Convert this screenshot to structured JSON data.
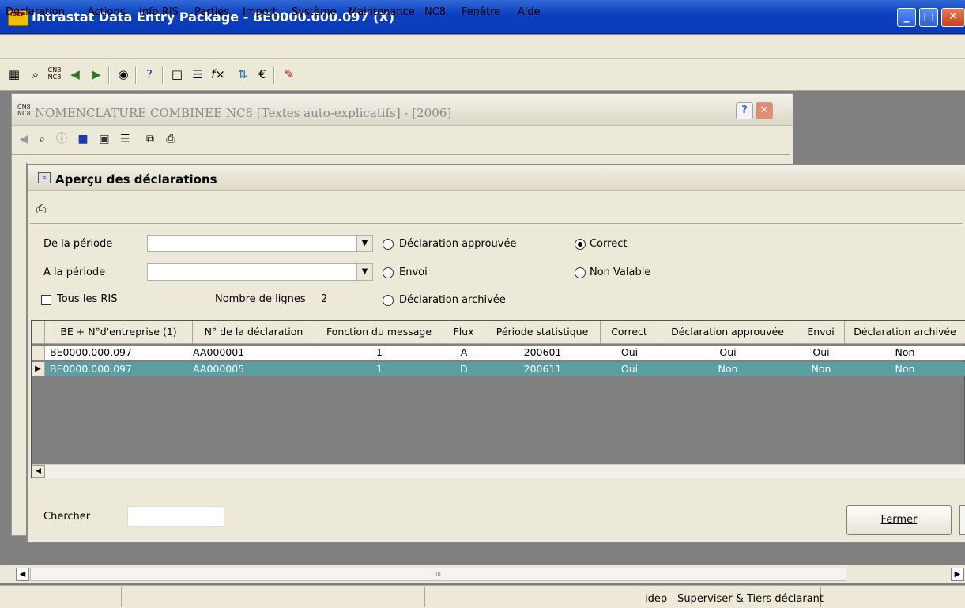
{
  "window": {
    "title": "Intrastat Data Entry Package - BE0000.000.097 (X)",
    "app_icon_text": "IDEP",
    "minimize": "_",
    "maximize": "□",
    "close": "✕"
  },
  "menu": [
    "Déclaration",
    "Actions",
    "Info RIS",
    "Parties",
    "Import",
    "Système",
    "Maintenance",
    "NC8",
    "Fenêtre",
    "Aide"
  ],
  "toolbar_icons": [
    "grid-icon",
    "binoculars-icon",
    "cn8-nc8-icon",
    "arrow-back-icon",
    "arrow-forward-icon",
    "camera-icon",
    "help-icon",
    "new-document-icon",
    "printer-config-icon",
    "function-icon",
    "sort-icon",
    "euro-icon",
    "tools-icon"
  ],
  "nc8_window": {
    "title": "NOMENCLATURE COMBINEE NC8 [Textes auto-explicatifs] - [2006]",
    "icon_text": "CN8\nNC8",
    "help": "?",
    "close": "✕"
  },
  "apercu": {
    "title": "Aperçu des déclarations",
    "from_period_label": "De la période",
    "from_period_value": "",
    "to_period_label": "A la période",
    "to_period_value": "",
    "all_ris_label": "Tous les RIS",
    "all_ris_checked": false,
    "lines_count_label": "Nombre de lignes",
    "lines_count_value": "2",
    "filters_left": [
      {
        "label": "Déclaration approuvée",
        "selected": false
      },
      {
        "label": "Envoi",
        "selected": false
      },
      {
        "label": "Déclaration archivée",
        "selected": false
      }
    ],
    "filters_right": [
      {
        "label": "Correct",
        "selected": true
      },
      {
        "label": "Non Valable",
        "selected": false
      }
    ],
    "columns": [
      "BE + N°d'entreprise (1)",
      "N° de la déclaration",
      "Fonction du message",
      "Flux",
      "Période statistique",
      "Correct",
      "Déclaration approuvée",
      "Envoi",
      "Déclaration archivée"
    ],
    "rows": [
      [
        "BE0000.000.097",
        "AA000001",
        "1",
        "A",
        "200601",
        "Oui",
        "Oui",
        "Oui",
        "Non"
      ],
      [
        "BE0000.000.097",
        "AA000005",
        "1",
        "D",
        "200611",
        "Oui",
        "Non",
        "Non",
        "Non"
      ]
    ],
    "selected_row": 1,
    "search_label": "Chercher",
    "search_value": "",
    "close_button": "Fermer"
  },
  "statusbar": {
    "scroll_thumb": "III",
    "user_text": "idep - Superviser & Tiers déclarant"
  },
  "colors": {
    "selected_row": "#5a9fa2",
    "titlebar": "#0a3fc0",
    "chrome": "#ece9d8",
    "workspace": "#808080"
  }
}
